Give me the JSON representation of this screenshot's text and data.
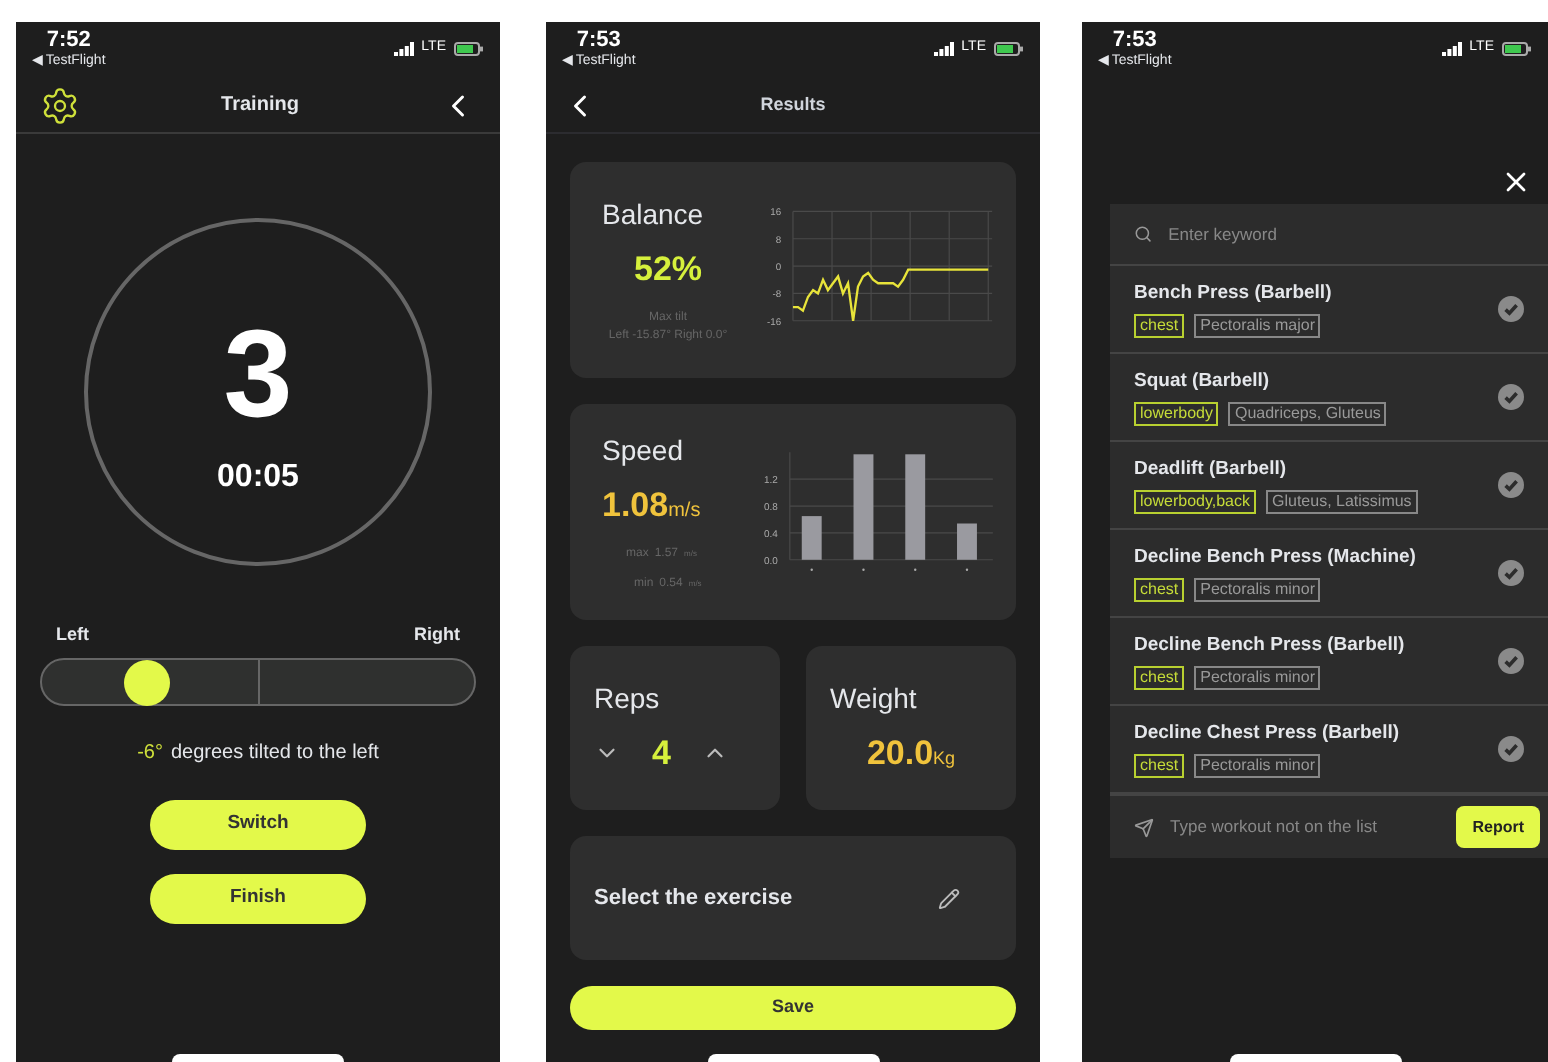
{
  "training": {
    "status": {
      "time": "7:52",
      "back_app": "◀ TestFlight",
      "network": "LTE"
    },
    "title": "Training",
    "count": "3",
    "timer": "00:05",
    "tilt": {
      "left_label": "Left",
      "right_label": "Right",
      "level": 0.24,
      "degrees": "-6°",
      "text": "degrees tilted to the left"
    },
    "buttons": [
      "Switch",
      "Finish"
    ]
  },
  "results": {
    "status": {
      "time": "7:53",
      "back_app": "◀ TestFlight",
      "network": "LTE"
    },
    "title": "Results",
    "balance": {
      "title": "Balance",
      "value": "52%",
      "note_title": "Max tilt",
      "note": "Left -15.87° Right 0.0°",
      "chart_data": {
        "type": "line",
        "grid": true,
        "ylim": [
          -16,
          16
        ],
        "yticks": [
          16,
          8,
          0,
          -8,
          -16
        ],
        "series": [
          {
            "color": "#e8e43a",
            "values": [
              -12,
              -12,
              -13,
              -9,
              -7,
              -8,
              -4,
              -7,
              -5,
              -3,
              -8,
              -5,
              -16,
              -6,
              -3,
              -2,
              -4,
              -5,
              -5,
              -5,
              -5,
              -6,
              -4,
              -1,
              -1,
              -1,
              -1,
              -1,
              -1,
              -1,
              -1,
              -1,
              -1,
              -1,
              -1,
              -1,
              -1,
              -1,
              -1,
              -1
            ]
          }
        ]
      }
    },
    "speed": {
      "title": "Speed",
      "value": "1.08",
      "unit": "m/s",
      "max_label": "max",
      "max": "1.57",
      "max_unit": "m/s",
      "min_label": "min",
      "min": "0.54",
      "min_unit": "m/s",
      "chart_data": {
        "type": "bar",
        "grid": true,
        "ylim": [
          0,
          1.6
        ],
        "yticks": [
          {
            "value": 0,
            "label": "0.0"
          },
          {
            "value": 0.4,
            "label": "0.4"
          },
          {
            "value": 0.8,
            "label": "0.8"
          },
          {
            "value": 1.2,
            "label": "1.2"
          }
        ],
        "values": [
          0.65,
          1.57,
          1.57,
          0.54
        ]
      }
    },
    "reps": {
      "title": "Reps",
      "value": "4"
    },
    "weight": {
      "title": "Weight",
      "value": "20.0",
      "unit": "Kg"
    },
    "exercise": {
      "label": "Select the exercise"
    },
    "save": "Save"
  },
  "picker": {
    "status": {
      "time": "7:53",
      "back_app": "◀ TestFlight",
      "network": "LTE"
    },
    "search": {
      "placeholder": "Enter keyword"
    },
    "exercises": [
      {
        "name": "Bench Press (Barbell)",
        "category": "chest",
        "muscles": "Pectoralis major"
      },
      {
        "name": "Squat (Barbell)",
        "category": "lowerbody",
        "muscles": "Quadriceps, Gluteus"
      },
      {
        "name": "Deadlift (Barbell)",
        "category": "lowerbody,back",
        "muscles": "Gluteus, Latissimus"
      },
      {
        "name": "Decline Bench Press (Machine)",
        "category": "chest",
        "muscles": "Pectoralis minor"
      },
      {
        "name": "Decline Bench Press (Barbell)",
        "category": "chest",
        "muscles": "Pectoralis minor"
      },
      {
        "name": "Decline Chest Press (Barbell)",
        "category": "chest",
        "muscles": "Pectoralis minor"
      }
    ],
    "report": {
      "placeholder": "Type workout not on the list",
      "button": "Report"
    }
  }
}
